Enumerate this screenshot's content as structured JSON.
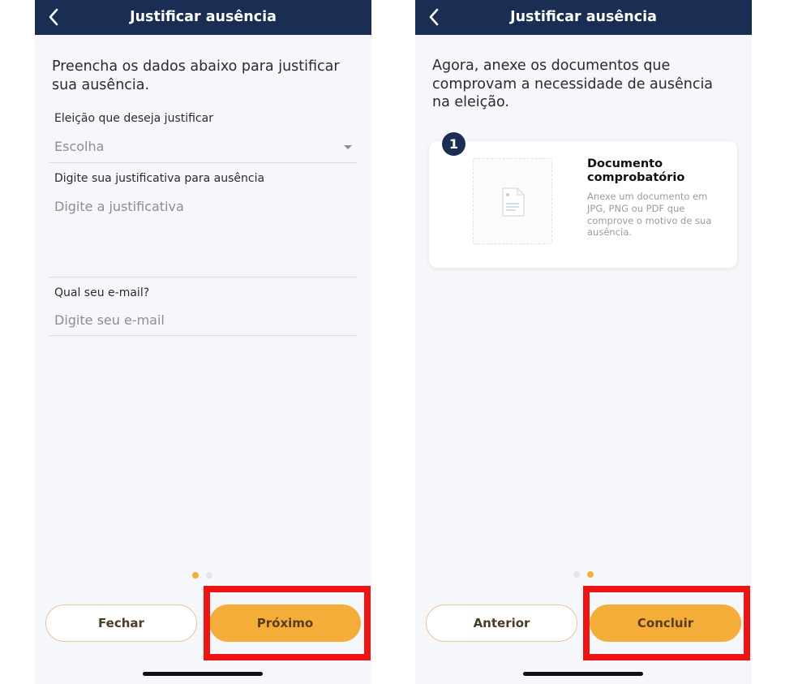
{
  "screen1": {
    "title": "Justificar ausência",
    "intro": "Preencha os dados abaixo para justificar sua ausência.",
    "election_label": "Eleição que deseja justificar",
    "election_select": "Escolha",
    "reason_label": "Digite sua justificativa para ausência",
    "reason_placeholder": "Digite a justificativa",
    "email_label": "Qual seu e-mail?",
    "email_placeholder": "Digite seu e-mail",
    "close_button": "Fechar",
    "next_button": "Próximo",
    "active_step": 1,
    "step_count": 2
  },
  "screen2": {
    "title": "Justificar ausência",
    "intro": "Agora, anexe os documentos que comprovam a necessidade de ausência na eleição.",
    "card_number": "1",
    "doc_title": "Documento comprobatório",
    "doc_desc": "Anexe um documento em JPG, PNG ou PDF que comprove o motivo de sua ausência.",
    "previous_button": "Anterior",
    "finish_button": "Concluir",
    "active_step": 2,
    "step_count": 2
  },
  "icons": {
    "back": "back-arrow-icon",
    "dropdown": "caret-down-icon",
    "document": "document-icon"
  },
  "colors": {
    "header": "#1a2d52",
    "accent": "#f5ad3a",
    "highlight": "#ef1414",
    "dot_active": "#f5ad3a",
    "dot_inactive": "#e4e6ec"
  }
}
